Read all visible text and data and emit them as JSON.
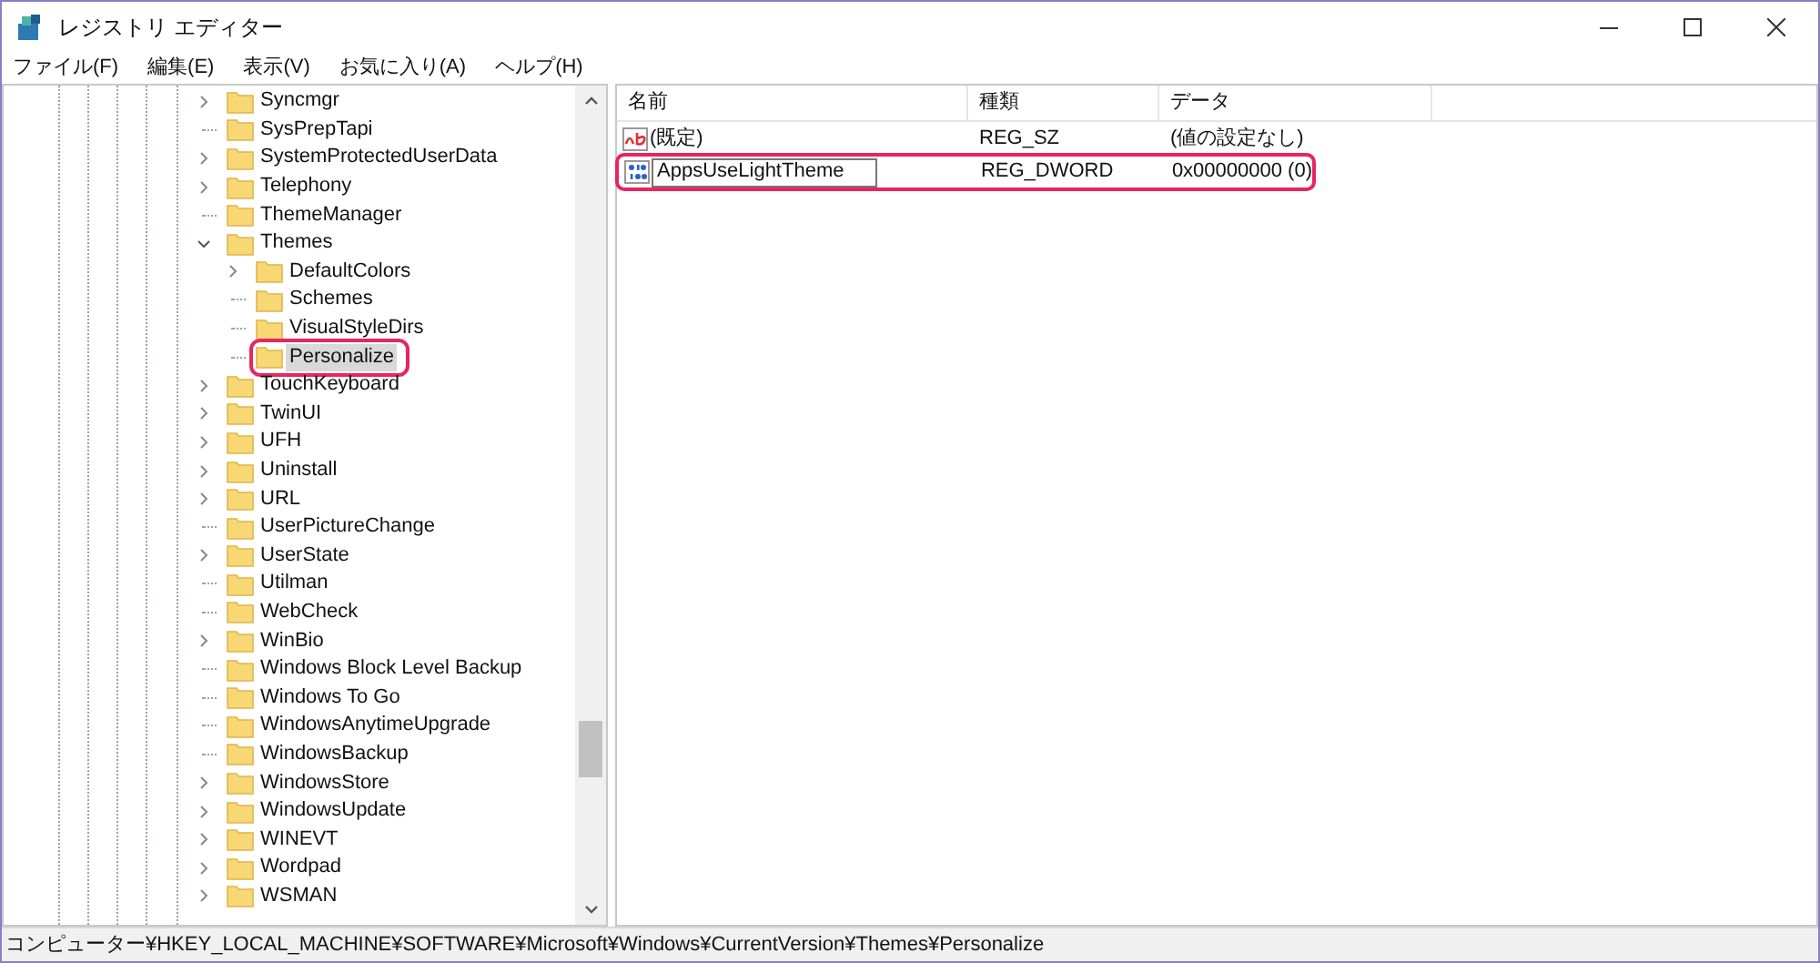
{
  "window": {
    "title": "レジストリ エディター"
  },
  "menu": [
    "ファイル(F)",
    "編集(E)",
    "表示(V)",
    "お気に入り(A)",
    "ヘルプ(H)"
  ],
  "tree": [
    {
      "kind": "collapsed",
      "label": "Syncmgr",
      "selected": false,
      "annotated": false
    },
    {
      "kind": "leaf",
      "label": "SysPrepTapi",
      "selected": false,
      "annotated": false
    },
    {
      "kind": "collapsed",
      "label": "SystemProtectedUserData",
      "selected": false,
      "annotated": false
    },
    {
      "kind": "collapsed",
      "label": "Telephony",
      "selected": false,
      "annotated": false
    },
    {
      "kind": "leaf",
      "label": "ThemeManager",
      "selected": false,
      "annotated": false
    },
    {
      "kind": "expanded",
      "label": "Themes",
      "selected": false,
      "annotated": false,
      "children": [
        {
          "kind": "collapsed",
          "label": "DefaultColors",
          "selected": false,
          "annotated": false
        },
        {
          "kind": "leaf",
          "label": "Schemes",
          "selected": false,
          "annotated": false
        },
        {
          "kind": "leaf",
          "label": "VisualStyleDirs",
          "selected": false,
          "annotated": false
        },
        {
          "kind": "leaf",
          "label": "Personalize",
          "selected": true,
          "annotated": true
        }
      ]
    },
    {
      "kind": "collapsed",
      "label": "TouchKeyboard",
      "selected": false,
      "annotated": false
    },
    {
      "kind": "collapsed",
      "label": "TwinUI",
      "selected": false,
      "annotated": false
    },
    {
      "kind": "collapsed",
      "label": "UFH",
      "selected": false,
      "annotated": false
    },
    {
      "kind": "collapsed",
      "label": "Uninstall",
      "selected": false,
      "annotated": false
    },
    {
      "kind": "collapsed",
      "label": "URL",
      "selected": false,
      "annotated": false
    },
    {
      "kind": "leaf",
      "label": "UserPictureChange",
      "selected": false,
      "annotated": false
    },
    {
      "kind": "collapsed",
      "label": "UserState",
      "selected": false,
      "annotated": false
    },
    {
      "kind": "leaf",
      "label": "Utilman",
      "selected": false,
      "annotated": false
    },
    {
      "kind": "leaf",
      "label": "WebCheck",
      "selected": false,
      "annotated": false
    },
    {
      "kind": "collapsed",
      "label": "WinBio",
      "selected": false,
      "annotated": false
    },
    {
      "kind": "leaf",
      "label": "Windows Block Level Backup",
      "selected": false,
      "annotated": false
    },
    {
      "kind": "leaf",
      "label": "Windows To Go",
      "selected": false,
      "annotated": false
    },
    {
      "kind": "leaf",
      "label": "WindowsAnytimeUpgrade",
      "selected": false,
      "annotated": false
    },
    {
      "kind": "leaf",
      "label": "WindowsBackup",
      "selected": false,
      "annotated": false
    },
    {
      "kind": "collapsed",
      "label": "WindowsStore",
      "selected": false,
      "annotated": false
    },
    {
      "kind": "collapsed",
      "label": "WindowsUpdate",
      "selected": false,
      "annotated": false
    },
    {
      "kind": "collapsed",
      "label": "WINEVT",
      "selected": false,
      "annotated": false
    },
    {
      "kind": "collapsed",
      "label": "Wordpad",
      "selected": false,
      "annotated": false
    },
    {
      "kind": "collapsed",
      "label": "WSMAN",
      "selected": false,
      "annotated": false
    }
  ],
  "values": {
    "columns": [
      "名前",
      "種類",
      "データ"
    ],
    "rows": [
      {
        "kind": "string",
        "name": "(既定)",
        "type": "REG_SZ",
        "data": "(値の設定なし)",
        "editing": false,
        "annotated": false
      },
      {
        "kind": "dword",
        "name": "AppsUseLightTheme",
        "type": "REG_DWORD",
        "data": "0x00000000 (0)",
        "editing": true,
        "annotated": true
      }
    ]
  },
  "status_bar": "コンピューター¥HKEY_LOCAL_MACHINE¥SOFTWARE¥Microsoft¥Windows¥CurrentVersion¥Themes¥Personalize"
}
